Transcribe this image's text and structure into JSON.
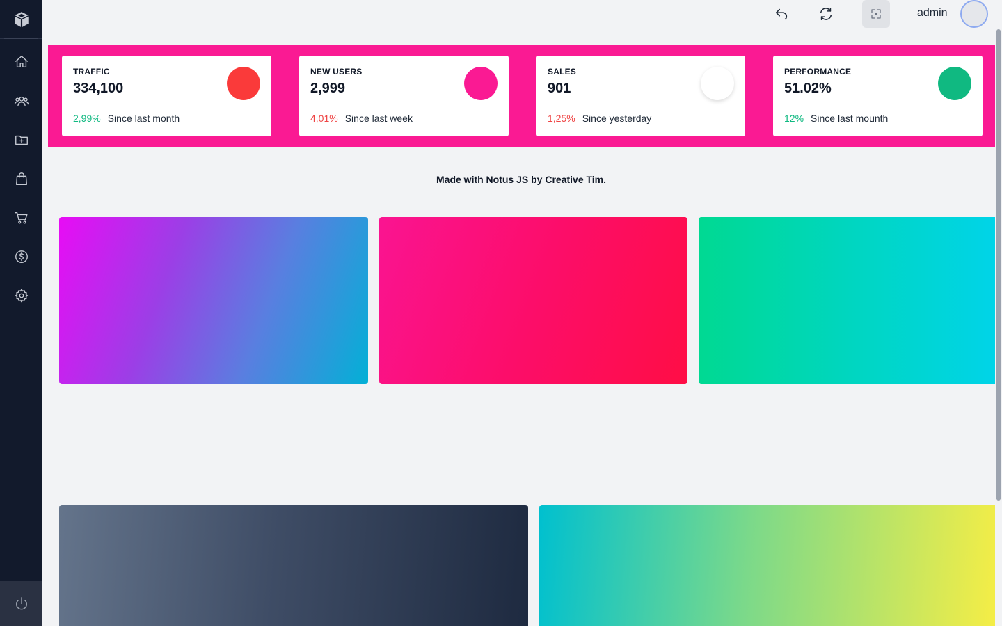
{
  "sidebar": {
    "logo": "box-logo-icon",
    "items": [
      {
        "name": "home",
        "icon": "home-icon"
      },
      {
        "name": "users",
        "icon": "users-group-icon"
      },
      {
        "name": "folder",
        "icon": "folder-plus-icon"
      },
      {
        "name": "bag",
        "icon": "shopping-bag-icon"
      },
      {
        "name": "cart",
        "icon": "cart-icon"
      },
      {
        "name": "billing",
        "icon": "dollar-circle-icon"
      },
      {
        "name": "settings",
        "icon": "gear-icon"
      }
    ],
    "power": "power-icon"
  },
  "topbar": {
    "undo": "undo-icon",
    "refresh": "refresh-icon",
    "focus": "focus-icon",
    "username": "admin"
  },
  "stats": [
    {
      "label": "TRAFFIC",
      "value": "334,100",
      "change": "2,99%",
      "change_color": "#10b981",
      "since": "Since last month",
      "circle_color": "#fa3a3a"
    },
    {
      "label": "NEW USERS",
      "value": "2,999",
      "change": "4,01%",
      "change_color": "#ef4444",
      "since": "Since last week",
      "circle_color": "#fa1a93"
    },
    {
      "label": "SALES",
      "value": "901",
      "change": "1,25%",
      "change_color": "#ef4444",
      "since": "Since yesterday",
      "circle_color": "#ffffff"
    },
    {
      "label": "PERFORMANCE",
      "value": "51.02%",
      "change": "12%",
      "change_color": "#10b981",
      "since": "Since last mounth",
      "circle_color": "#10b981"
    }
  ],
  "footer_text": "Made with Notus JS by Creative Tim.",
  "colors": {
    "band": "#fa1a93",
    "sidebar": "#121a2c",
    "background": "#f2f3f5"
  }
}
